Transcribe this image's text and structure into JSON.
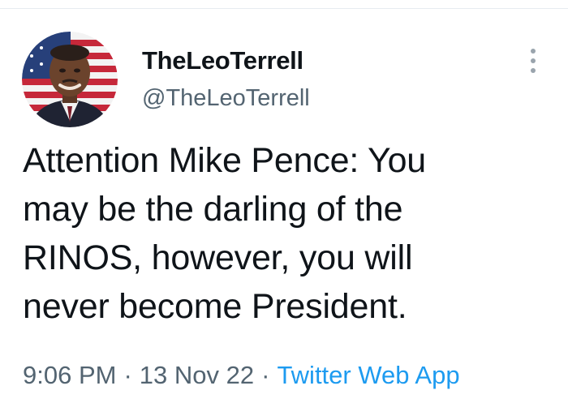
{
  "tweet": {
    "display_name": "TheLeoTerrell",
    "handle": "@TheLeoTerrell",
    "text_lines": [
      "Attention Mike Pence: You",
      "may be the darling of the",
      "RINOS, however, you will",
      "never become President."
    ],
    "time": "9:06 PM",
    "date": "13 Nov 22",
    "source": "Twitter Web App",
    "separator": "·"
  },
  "icons": {
    "more": "more-vertical-icon"
  },
  "colors": {
    "text_primary": "#0f1419",
    "text_secondary": "#536471",
    "link": "#1d9bf0",
    "divider": "#e6ecf0",
    "background": "#ffffff"
  }
}
